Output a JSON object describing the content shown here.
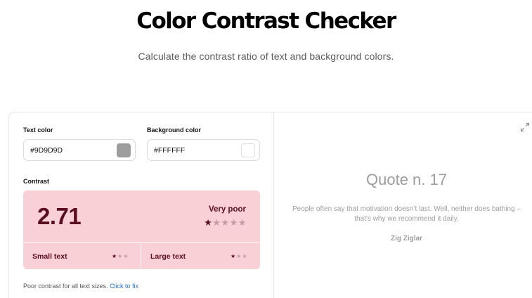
{
  "page": {
    "title": "Color Contrast Checker",
    "subtitle": "Calculate the contrast ratio of text and background colors."
  },
  "text_color": {
    "label": "Text color",
    "value": "#9D9D9D",
    "swatch": "#9D9D9D"
  },
  "background_color": {
    "label": "Background color",
    "value": "#FFFFFF",
    "swatch": "#FFFFFF"
  },
  "contrast": {
    "label": "Contrast",
    "ratio": "2.71",
    "rating": "Very poor",
    "rating_stars": 1,
    "rating_stars_max": 5,
    "box_color": "#F9D0D6",
    "small_text": {
      "label": "Small text",
      "stars": 1,
      "max": 3
    },
    "large_text": {
      "label": "Large text",
      "stars": 1,
      "max": 3
    }
  },
  "hint": {
    "text": "Poor contrast for all text sizes.",
    "link": "Click to fix"
  },
  "preview": {
    "title": "Quote n. 17",
    "quote": "People often say that motivation doesn’t last. Well, neither does bathing – that’s why we recommend it daily.",
    "author": "Zig Ziglar",
    "icon": "expand-icon"
  }
}
